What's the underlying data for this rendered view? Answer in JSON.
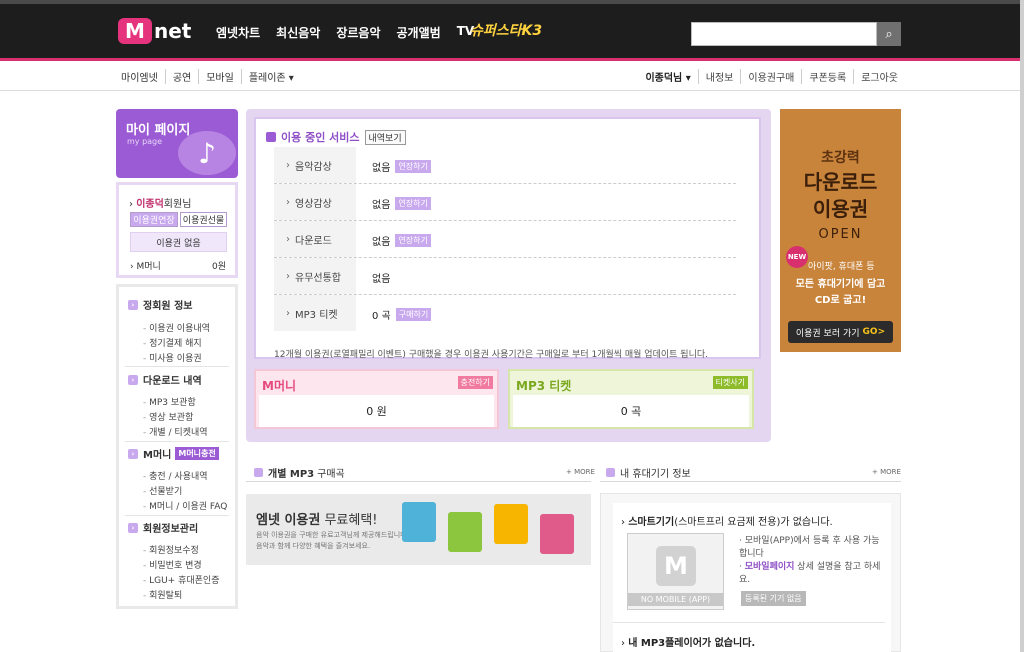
{
  "header": {
    "logo_m": "M",
    "logo_net": "net",
    "nav": [
      "엠넷차트",
      "최신음악",
      "장르음악",
      "공개앨범",
      "TV"
    ],
    "superstar": "슈퍼스타K3",
    "search_placeholder": "",
    "search_icon": "search-icon"
  },
  "subnav": {
    "left": [
      "마이엠넷",
      "공연",
      "모바일",
      "플레이존 ▾"
    ],
    "user": "이종덕님 ▾",
    "right": [
      "내정보",
      "이용권구매",
      "쿠폰등록",
      "로그아웃"
    ]
  },
  "sidebar": {
    "mypage_title": "마이 페이지",
    "mypage_sub": "my page",
    "user_name": "이종덕",
    "user_suffix": "회원님",
    "btn_extend": "이용권연장",
    "btn_gift": "이용권선물",
    "pass_none": "없음",
    "pass_label": "이용권",
    "mmoney_label": "M머니",
    "mmoney_value": "0원",
    "sections": [
      {
        "title": "정회원 정보",
        "items": [
          "이용권 이용내역",
          "정기결제 해지",
          "미사용 이용권"
        ]
      },
      {
        "title": "다운로드 내역",
        "items": [
          "MP3 보관함",
          "영상 보관함",
          "개별 / 티켓내역"
        ]
      },
      {
        "title": "M머니",
        "tag": "M머니충전",
        "items": [
          "충전 / 사용내역",
          "선물받기",
          "M머니 / 이용권 FAQ"
        ]
      },
      {
        "title": "회원정보관리",
        "items": [
          "회원정보수정",
          "비밀번호 변경",
          "LGU+ 휴대폰인증",
          "회원탈퇴"
        ]
      }
    ]
  },
  "services": {
    "title": "이용 중인 서비스",
    "history_btn": "내역보기",
    "rows": [
      {
        "label": "음악감상",
        "value": "없음",
        "action": "연장하기"
      },
      {
        "label": "영상감상",
        "value": "없음",
        "action": "연장하기"
      },
      {
        "label": "다운로드",
        "value": "없음",
        "action": "연장하기"
      },
      {
        "label": "유무선통합",
        "value": "없음",
        "action": ""
      },
      {
        "label": "MP3 티켓",
        "value": "0 곡",
        "action": "구매하기"
      }
    ],
    "note": "12개월 이용권(로열패밀리 이벤트) 구매했을 경우 이용권 사용기간은 구매일로 부터 1개월씩 매월 업데이트 됩니다."
  },
  "mmoney_box": {
    "title": "M머니",
    "button": "충전하기",
    "value": "0 원"
  },
  "mp3_box": {
    "title": "MP3 티켓",
    "button": "티켓사기",
    "value": "0 곡"
  },
  "ad": {
    "line1": "초강력",
    "line2": "다운로드",
    "line3": "이용권",
    "line4": "OPEN",
    "new": "NEW",
    "line5": "아이팟, 휴대폰 등",
    "line6": "모든 휴대기기에 담고",
    "line7": "CD로 굽고!",
    "go": "이용권 보러 가기",
    "go_arrow": "GO>"
  },
  "mp3_section": {
    "title_bold": "개별 MP3",
    "title_rest": "구매곡",
    "more": "+ MORE",
    "banner_title_bold": "엠넷 이용권",
    "banner_title_rest": " 무료혜택!",
    "banner_desc1": "음악 이용권을 구매한 유료고객님께 제공해드립니다.",
    "banner_desc2": "음악과 함께 다양한 혜택을 즐겨보세요."
  },
  "device_section": {
    "title": "내 휴대기기 정보",
    "more": "+ MORE",
    "smart_bold": "스마트기기",
    "smart_rest": "(스마트프리 요금제 전용)가 없습니다.",
    "no_mobile": "NO MOBILE (APP)",
    "desc1": "모바일(APP)에서 등록 후 사용 가능합니다",
    "desc2_bold": "모바일페이지",
    "desc2_rest": " 상세 설명을 참고 하세요.",
    "registered_btn": "등록된 기기 없음",
    "mp3player": "내 MP3플레이어가 없습니다."
  }
}
